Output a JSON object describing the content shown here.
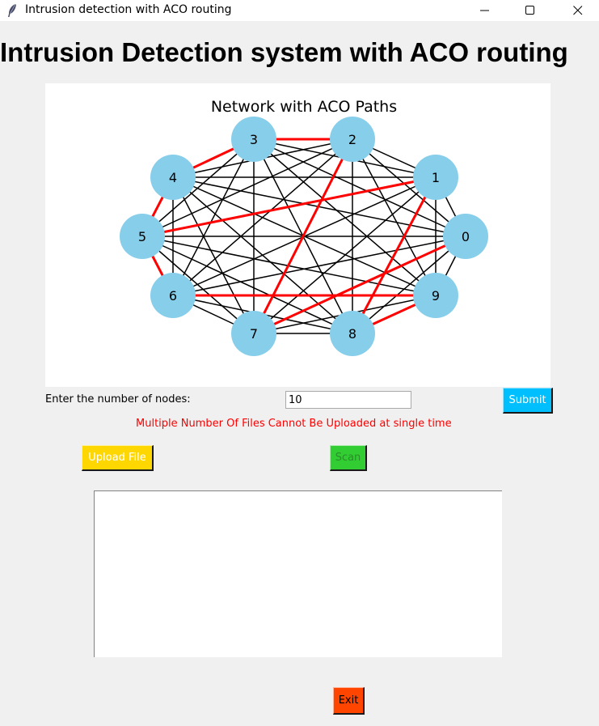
{
  "window": {
    "title": "Intrusion detection with ACO routing",
    "controls": {
      "minimize": "minimize-icon",
      "maximize": "maximize-icon",
      "close": "close-icon"
    }
  },
  "heading": "Intrusion Detection system with ACO routing",
  "plot": {
    "title": "Network with ACO Paths",
    "node_color": "#87ceeb",
    "edge_color": "#000000",
    "path_color": "#ff0000",
    "nodes": [
      "0",
      "1",
      "2",
      "3",
      "4",
      "5",
      "6",
      "7",
      "8",
      "9"
    ],
    "aco_paths": [
      [
        "3",
        "2"
      ],
      [
        "3",
        "4"
      ],
      [
        "4",
        "5"
      ],
      [
        "5",
        "6"
      ],
      [
        "6",
        "9"
      ],
      [
        "5",
        "1"
      ],
      [
        "2",
        "7"
      ],
      [
        "7",
        "0"
      ],
      [
        "1",
        "8"
      ],
      [
        "8",
        "9"
      ]
    ]
  },
  "form": {
    "nodes_label": "Enter the number of nodes:",
    "nodes_value": "10",
    "submit_label": "Submit"
  },
  "warning": "Multiple Number Of Files Cannot Be Uploaded at single time",
  "buttons": {
    "upload": "Upload File",
    "scan": "Scan",
    "exit": "Exit"
  },
  "output_text": ""
}
